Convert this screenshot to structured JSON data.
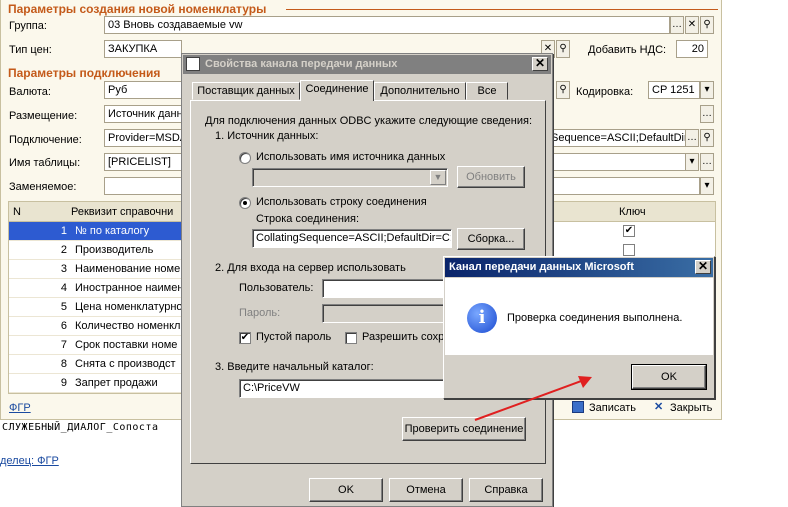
{
  "form": {
    "section_new": "Параметры создания новой номенклатуры",
    "group_label": "Группа:",
    "group_value": "03 Вновь создаваемые vw",
    "price_type_label": "Тип цен:",
    "price_type_value": "ЗАКУПКА",
    "vat_label": "Добавить НДС:",
    "vat_value": "20",
    "section_conn": "Параметры подключения",
    "currency_label": "Валюта:",
    "currency_value": "Руб",
    "encoding_label": "Кодировка:",
    "encoding_value": "CP 1251",
    "location_label": "Размещение:",
    "location_value": "Источник данн",
    "connection_label": "Подключение:",
    "connection_value": "Provider=MSDA",
    "connection_value_tail": "Sequence=ASCII;DefaultDir",
    "table_label": "Имя таблицы:",
    "table_value": "[PRICELIST]",
    "replace_label": "Заменяемое:",
    "col_n": "N",
    "col_req": "Реквизит справочни",
    "col_key": "Ключ",
    "rows": [
      {
        "n": "1",
        "name": "№ по каталогу",
        "key": true
      },
      {
        "n": "2",
        "name": "Производитель",
        "key": false
      },
      {
        "n": "3",
        "name": "Наименование номе",
        "key": false
      },
      {
        "n": "4",
        "name": "Иностранное наимен",
        "key": false
      },
      {
        "n": "5",
        "name": "Цена номенклатурно",
        "key": false
      },
      {
        "n": "6",
        "name": "Количество номенкл",
        "key": false
      },
      {
        "n": "7",
        "name": "Срок поставки номе",
        "key": false
      },
      {
        "n": "8",
        "name": "Снята с производст",
        "key": false
      },
      {
        "n": "9",
        "name": "Запрет продажи",
        "key": false
      }
    ],
    "fgr_link": "ФГР",
    "save_label": "Записать",
    "close_label": "Закрыть"
  },
  "status": {
    "service_text": "СЛУЖЕБНЫЙ_ДИАЛОГ_Сопоста",
    "bottom_link": "делец: ФГР"
  },
  "props_dialog": {
    "title": "Свойства канала передачи данных",
    "tabs": [
      "Поставщик данных",
      "Соединение",
      "Дополнительно",
      "Все"
    ],
    "intro": "Для подключения данных ODBC укажите следующие сведения:",
    "step1": "1. Источник данных:",
    "use_dsn": "Использовать имя источника данных",
    "refresh": "Обновить",
    "use_conn_string": "Использовать строку соединения",
    "conn_string_label": "Строка соединения:",
    "conn_string_value": "CollatingSequence=ASCII;DefaultDir=C:\\",
    "build": "Сборка...",
    "step2": "2. Для входа на сервер использовать",
    "user_label": "Пользователь:",
    "password_label": "Пароль:",
    "blank_password": "Пустой пароль",
    "allow_save": "Разрешить сохр",
    "step3": "3. Введите начальный каталог:",
    "catalog_value": "C:\\PriceVW",
    "test_button": "Проверить соединение",
    "ok": "OK",
    "cancel": "Отмена",
    "help": "Справка"
  },
  "msg_dialog": {
    "title": "Канал передачи данных Microsoft",
    "message": "Проверка соединения выполнена.",
    "ok": "OK"
  },
  "colors": {
    "accent": "#c45a1a",
    "selection": "#2d5bd1",
    "arrow": "#e02020",
    "title_active": "#0a246a"
  }
}
